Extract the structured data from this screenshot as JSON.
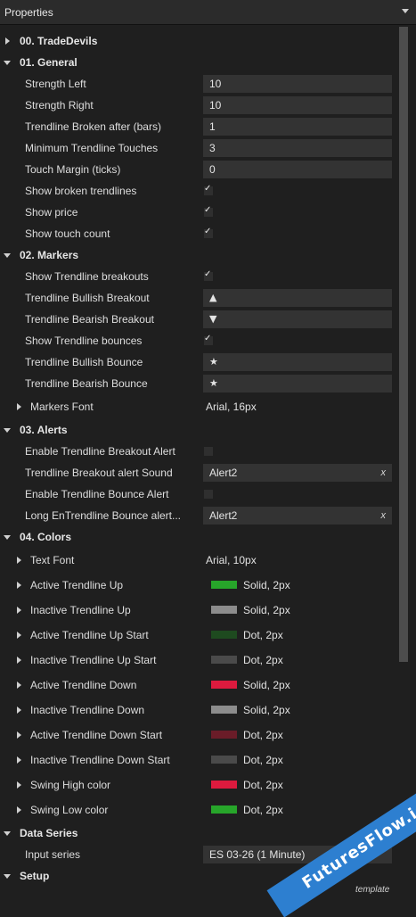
{
  "panel": {
    "title": "Properties"
  },
  "categories": {
    "tradedevils": "00. TradeDevils",
    "general": "01. General",
    "markers": "02. Markers",
    "alerts": "03. Alerts",
    "colors": "04. Colors",
    "data_series": "Data Series",
    "setup": "Setup"
  },
  "general": {
    "strength_left": {
      "label": "Strength Left",
      "value": "10"
    },
    "strength_right": {
      "label": "Strength Right",
      "value": "10"
    },
    "broken_after": {
      "label": "Trendline Broken after (bars)",
      "value": "1"
    },
    "min_touches": {
      "label": "Minimum Trendline Touches",
      "value": "3"
    },
    "touch_margin": {
      "label": "Touch Margin (ticks)",
      "value": "0"
    },
    "show_broken": {
      "label": "Show broken trendlines",
      "checked": true
    },
    "show_price": {
      "label": "Show price",
      "checked": true
    },
    "show_touch_count": {
      "label": "Show touch count",
      "checked": true
    }
  },
  "markers": {
    "show_breakouts": {
      "label": "Show Trendline breakouts",
      "checked": true
    },
    "bull_breakout": {
      "label": "Trendline Bullish Breakout",
      "value": "▲"
    },
    "bear_breakout": {
      "label": "Trendline Bearish Breakout",
      "value": "▼"
    },
    "show_bounces": {
      "label": "Show Trendline bounces",
      "checked": true
    },
    "bull_bounce": {
      "label": "Trendline Bullish Bounce",
      "value": "★"
    },
    "bear_bounce": {
      "label": "Trendline Bearish Bounce",
      "value": "★"
    },
    "font": {
      "label": "Markers Font",
      "value": "Arial, 16px"
    }
  },
  "alerts": {
    "enable_breakout": {
      "label": "Enable Trendline Breakout Alert",
      "checked": false
    },
    "breakout_sound": {
      "label": "Trendline Breakout alert Sound",
      "value": "Alert2",
      "clear": "x"
    },
    "enable_bounce": {
      "label": "Enable Trendline Bounce Alert",
      "checked": false
    },
    "bounce_sound": {
      "label": "Long EnTrendline Bounce alert...",
      "value": "Alert2",
      "clear": "x"
    }
  },
  "colors": {
    "text_font": {
      "label": "Text Font",
      "value": "Arial, 10px"
    },
    "items": [
      {
        "label": "Active Trendline Up",
        "color": "#27a52a",
        "style": "Solid, 2px"
      },
      {
        "label": "Inactive Trendline Up",
        "color": "#8c8c8c",
        "style": "Solid, 2px"
      },
      {
        "label": "Active Trendline Up Start",
        "color": "#1e4a1f",
        "style": "Dot, 2px"
      },
      {
        "label": "Inactive Trendline Up Start",
        "color": "#4a4a4a",
        "style": "Dot, 2px"
      },
      {
        "label": "Active Trendline Down",
        "color": "#dc1a3e",
        "style": "Solid, 2px"
      },
      {
        "label": "Inactive Trendline Down",
        "color": "#8c8c8c",
        "style": "Solid, 2px"
      },
      {
        "label": "Active Trendline Down Start",
        "color": "#6a1c28",
        "style": "Dot, 2px"
      },
      {
        "label": "Inactive Trendline Down Start",
        "color": "#4a4a4a",
        "style": "Dot, 2px"
      },
      {
        "label": "Swing High color",
        "color": "#dc1a3e",
        "style": "Dot, 2px"
      },
      {
        "label": "Swing Low color",
        "color": "#27a52a",
        "style": "Dot, 2px"
      }
    ]
  },
  "data_series": {
    "input_series": {
      "label": "Input series",
      "value": "ES 03-26 (1 Minute)"
    }
  },
  "watermark": {
    "text": "FuturesFlow.io",
    "color": "#2d7fd0"
  },
  "footer": {
    "template": "template"
  }
}
